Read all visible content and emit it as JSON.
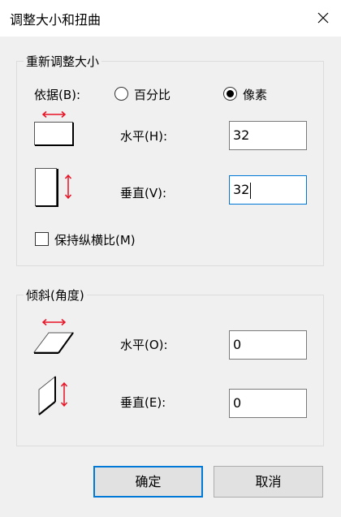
{
  "dialog": {
    "title": "调整大小和扭曲"
  },
  "resize": {
    "group_title": "重新调整大小",
    "by_label": "依据(B):",
    "options": [
      "百分比",
      "像素"
    ],
    "selected": "像素",
    "horizontal_label": "水平(H):",
    "horizontal_value": "32",
    "vertical_label": "垂直(V):",
    "vertical_value": "32",
    "keep_ratio_label": "保持纵横比(M)",
    "keep_ratio_checked": false
  },
  "skew": {
    "group_title": "倾斜(角度)",
    "horizontal_label": "水平(O):",
    "horizontal_value": "0",
    "vertical_label": "垂直(E):",
    "vertical_value": "0"
  },
  "buttons": {
    "ok": "确定",
    "cancel": "取消"
  },
  "colors": {
    "accent": "#0078d7",
    "arrow": "#e81123",
    "background": "#f0f0f0"
  }
}
